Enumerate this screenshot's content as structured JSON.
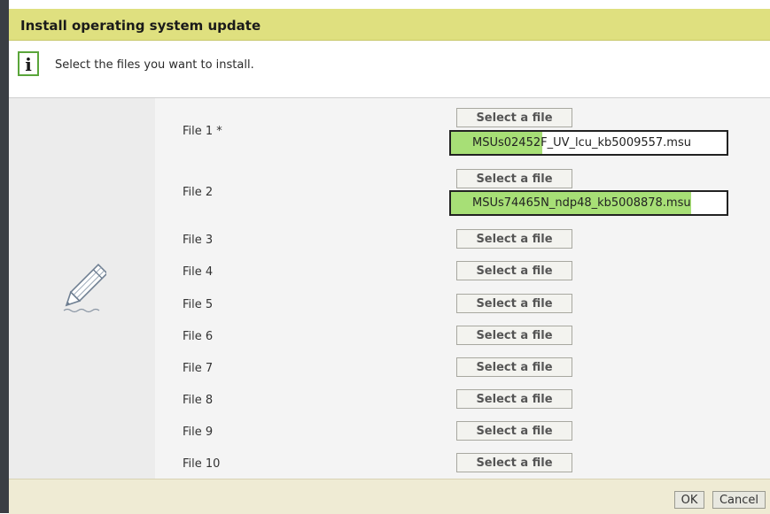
{
  "dialog": {
    "title": "Install operating system update",
    "info_icon": "info-icon",
    "info_text": "Select the files you want to install."
  },
  "rows": [
    {
      "label": "File 1 *",
      "button": "Select a file",
      "selected_file": "MSUs02452F_UV_lcu_kb5009557.msu",
      "upload_progress": 0.33
    },
    {
      "label": "File 2",
      "button": "Select a file",
      "selected_file": "MSUs74465N_ndp48_kb5008878.msu",
      "upload_progress": 0.87
    },
    {
      "label": "File 3",
      "button": "Select a file"
    },
    {
      "label": "File 4",
      "button": "Select a file"
    },
    {
      "label": "File 5",
      "button": "Select a file"
    },
    {
      "label": "File 6",
      "button": "Select a file"
    },
    {
      "label": "File 7",
      "button": "Select a file"
    },
    {
      "label": "File 8",
      "button": "Select a file"
    },
    {
      "label": "File 9",
      "button": "Select a file"
    },
    {
      "label": "File 10",
      "button": "Select a file"
    }
  ],
  "footer": {
    "ok_label": "OK",
    "cancel_label": "Cancel"
  },
  "colors": {
    "title_bar": "#dfe07f",
    "progress_fill": "#a7df76",
    "info_icon_border": "#5aa53a",
    "footer": "#efebd4"
  },
  "decoration": {
    "side_icon": "pencil-icon"
  }
}
